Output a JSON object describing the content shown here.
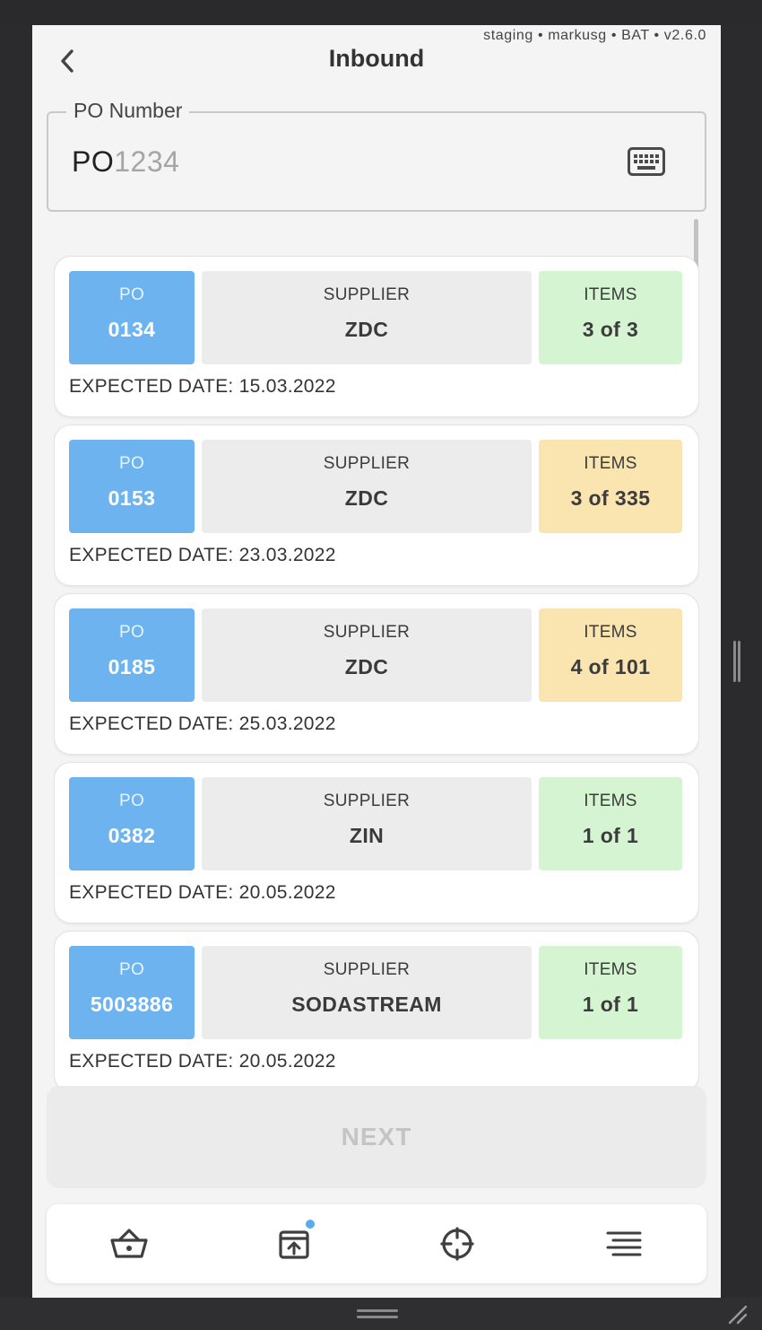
{
  "env_info": "staging • markusg • BAT • v2.6.0",
  "header": {
    "title": "Inbound"
  },
  "po_field": {
    "label": "PO Number",
    "prefix": "PO",
    "placeholder": "1234"
  },
  "orders": [
    {
      "po_label": "PO",
      "po": "0134",
      "supplier_label": "SUPPLIER",
      "supplier": "ZDC",
      "items_label": "ITEMS",
      "items": "3 of 3",
      "status": "complete",
      "date_label": "EXPECTED DATE: 15.03.2022"
    },
    {
      "po_label": "PO",
      "po": "0153",
      "supplier_label": "SUPPLIER",
      "supplier": "ZDC",
      "items_label": "ITEMS",
      "items": "3 of 335",
      "status": "partial",
      "date_label": "EXPECTED DATE: 23.03.2022"
    },
    {
      "po_label": "PO",
      "po": "0185",
      "supplier_label": "SUPPLIER",
      "supplier": "ZDC",
      "items_label": "ITEMS",
      "items": "4 of 101",
      "status": "partial",
      "date_label": "EXPECTED DATE: 25.03.2022"
    },
    {
      "po_label": "PO",
      "po": "0382",
      "supplier_label": "SUPPLIER",
      "supplier": "ZIN",
      "items_label": "ITEMS",
      "items": "1 of 1",
      "status": "complete",
      "date_label": "EXPECTED DATE: 20.05.2022"
    },
    {
      "po_label": "PO",
      "po": "5003886",
      "supplier_label": "SUPPLIER",
      "supplier": "SODASTREAM",
      "items_label": "ITEMS",
      "items": "1 of 1",
      "status": "complete",
      "date_label": "EXPECTED DATE: 20.05.2022"
    }
  ],
  "next_button": {
    "label": "NEXT"
  },
  "bottom_nav": {
    "items": [
      "basket-icon",
      "inbound-icon",
      "crosshair-icon",
      "menu-icon"
    ]
  },
  "colors": {
    "po_tile": "#6db3f0",
    "complete": "#d5f5d2",
    "partial": "#fae5b1",
    "badge": "#5aaaf0"
  }
}
